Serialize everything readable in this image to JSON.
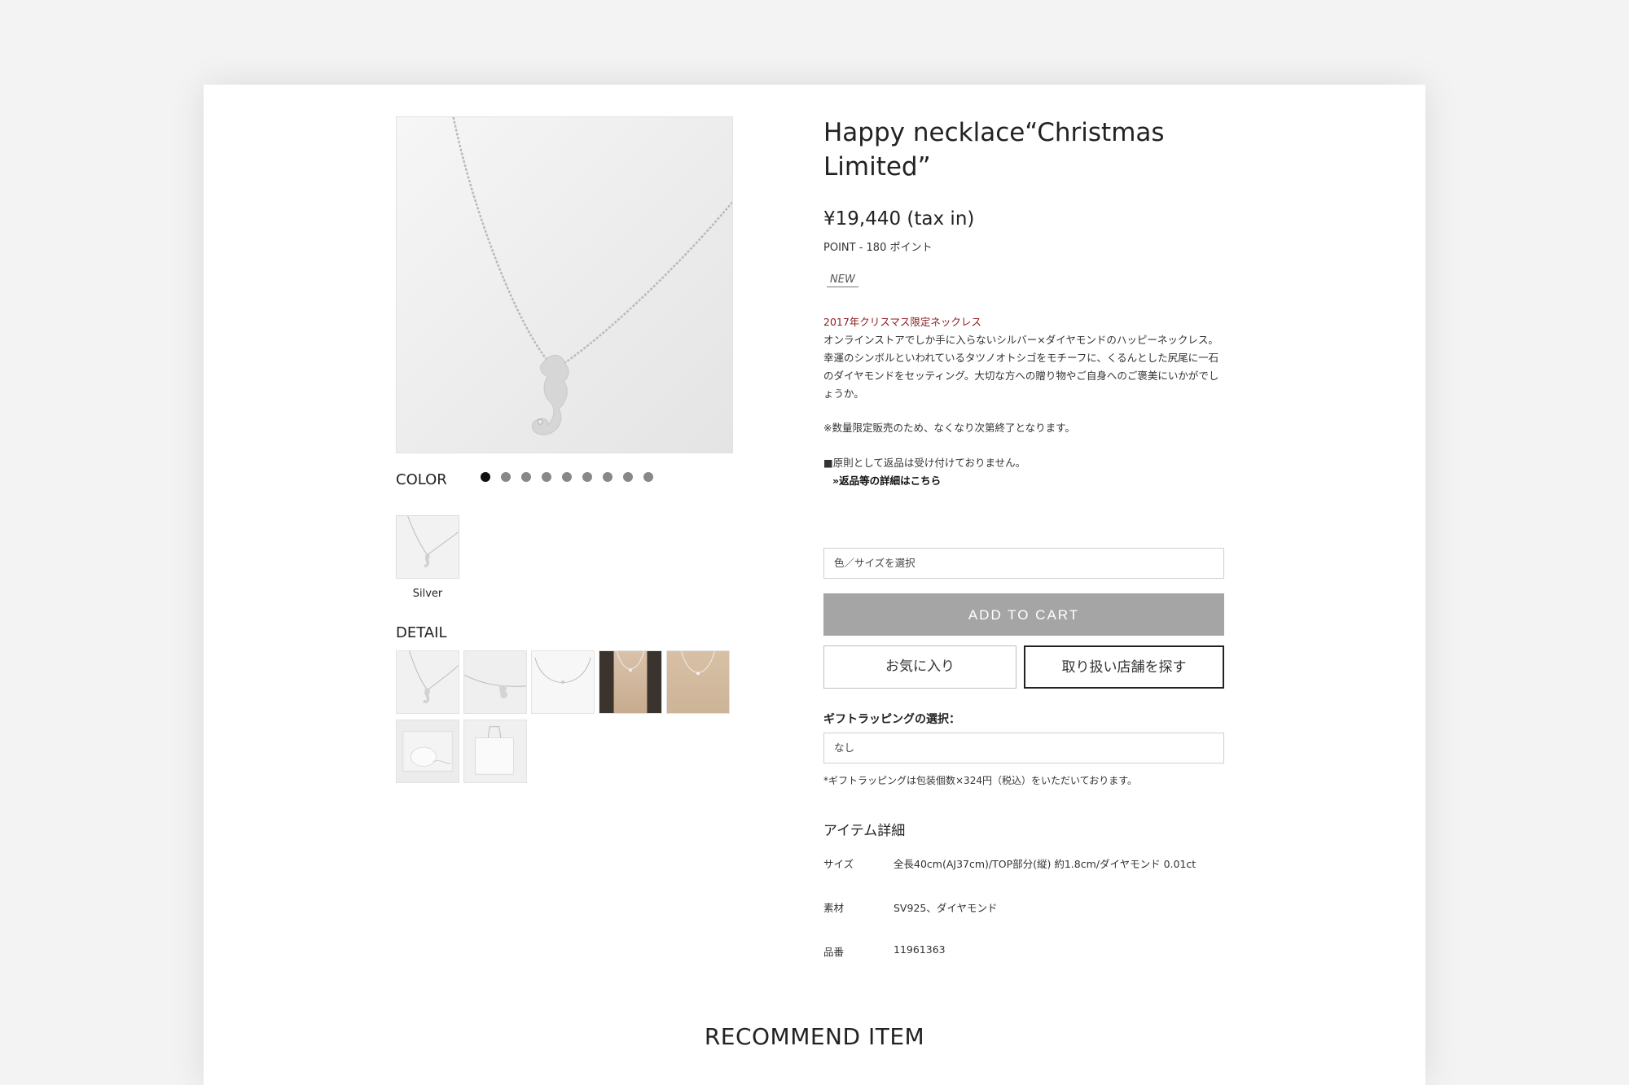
{
  "product": {
    "title": "Happy necklace“Christmas Limited”",
    "price": "¥19,440 (tax in)",
    "point": "POINT - 180 ポイント",
    "badge": "NEW",
    "description_highlight": "2017年クリスマス限定ネックレス",
    "description_lines": [
      "オンラインストアでしか手に入らないシルバー×ダイヤモンドのハッピーネックレス。",
      "幸運のシンボルといわれているタツノオトシゴをモチーフに、くるんとした尻尾に一石",
      "のダイヤモンドをセッティング。大切な方への贈り物やご自身へのご褒美にいかがでし",
      "ょうか。"
    ],
    "limited_notice": "※数量限定販売のため、なくなり次第終了となります。",
    "return_notice": "■原則として返品は受け付けておりません。",
    "return_link": "»返品等の詳細はこちら"
  },
  "gallery": {
    "color_label": "COLOR",
    "dot_count": 9,
    "active_dot": 0,
    "swatch_label": "Silver",
    "detail_label": "DETAIL"
  },
  "purchase": {
    "variant_placeholder": "色／サイズを選択",
    "add_to_cart": "ADD TO CART",
    "favorite": "お気に入り",
    "find_store": "取り扱い店舗を探す",
    "gift_label": "ギフトラッピングの選択：",
    "gift_value": "なし",
    "gift_note": "*ギフトラッピングは包装個数×324円（税込）をいただいております。"
  },
  "item_detail": {
    "heading": "アイテム詳細",
    "specs": [
      {
        "key": "サイズ",
        "value": "全長40cm(AJ37cm)/TOP部分(縦) 約1.8cm/ダイヤモンド 0.01ct"
      },
      {
        "key": "素材",
        "value": "SV925、ダイヤモンド"
      },
      {
        "key": "品番",
        "value": "11961363"
      }
    ]
  },
  "recommend_heading": "RECOMMEND ITEM",
  "colors": {
    "page_bg": "#f3f3f3",
    "highlight_red": "#8b1a1a",
    "cart_button": "#a5a5a5"
  }
}
